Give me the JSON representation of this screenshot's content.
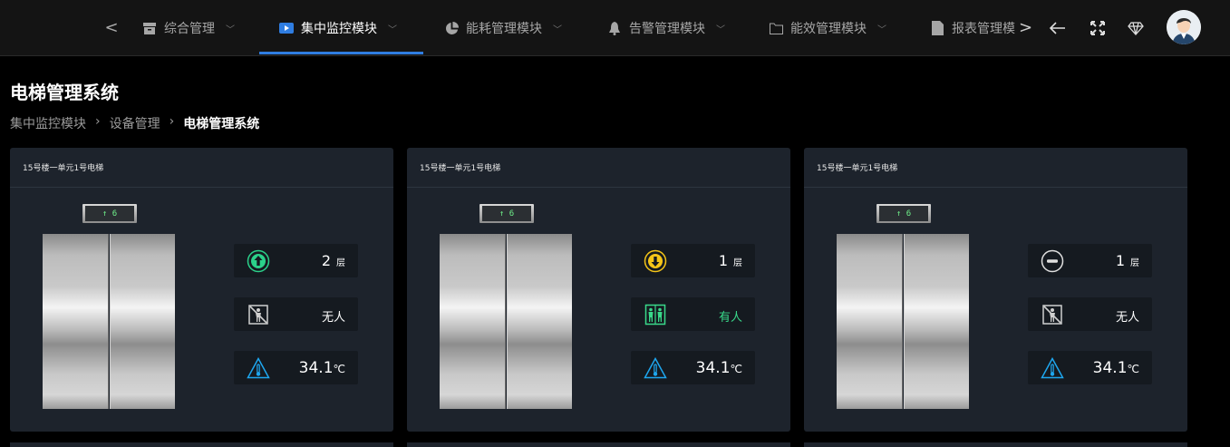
{
  "nav": {
    "prev": "<",
    "next": ">",
    "tabs": [
      {
        "label": "综合管理",
        "icon": "archive-icon",
        "active": false
      },
      {
        "label": "集中监控模块",
        "icon": "video-icon",
        "active": true
      },
      {
        "label": "能耗管理模块",
        "icon": "pie-chart-icon",
        "active": false
      },
      {
        "label": "告警管理模块",
        "icon": "bell-icon",
        "active": false
      },
      {
        "label": "能效管理模块",
        "icon": "folder-icon",
        "active": false
      },
      {
        "label": "报表管理模",
        "icon": "file-icon",
        "active": false
      }
    ],
    "accent": "#2f7de1"
  },
  "page": {
    "title": "电梯管理系统",
    "breadcrumb": [
      "集中监控模块",
      "设备管理",
      "电梯管理系统"
    ]
  },
  "elevators": [
    {
      "name": "15号楼一单元1号电梯",
      "indicator": "↑ 6",
      "floor": "2",
      "floor_unit": "层",
      "direction": "up",
      "occupancy": "无人",
      "occupied": false,
      "temperature": "34.1",
      "temp_unit": "℃"
    },
    {
      "name": "15号楼一单元1号电梯",
      "indicator": "↑ 6",
      "floor": "1",
      "floor_unit": "层",
      "direction": "down",
      "occupancy": "有人",
      "occupied": true,
      "temperature": "34.1",
      "temp_unit": "℃"
    },
    {
      "name": "15号楼一单元1号电梯",
      "indicator": "↑ 6",
      "floor": "1",
      "floor_unit": "层",
      "direction": "idle",
      "occupancy": "无人",
      "occupied": false,
      "temperature": "34.1",
      "temp_unit": "℃"
    }
  ],
  "colors": {
    "up": "#2bd18a",
    "down": "#f5c518",
    "idle": "#e0e0e0",
    "occupied": "#39d98a",
    "temp": "#1ea7f0"
  }
}
